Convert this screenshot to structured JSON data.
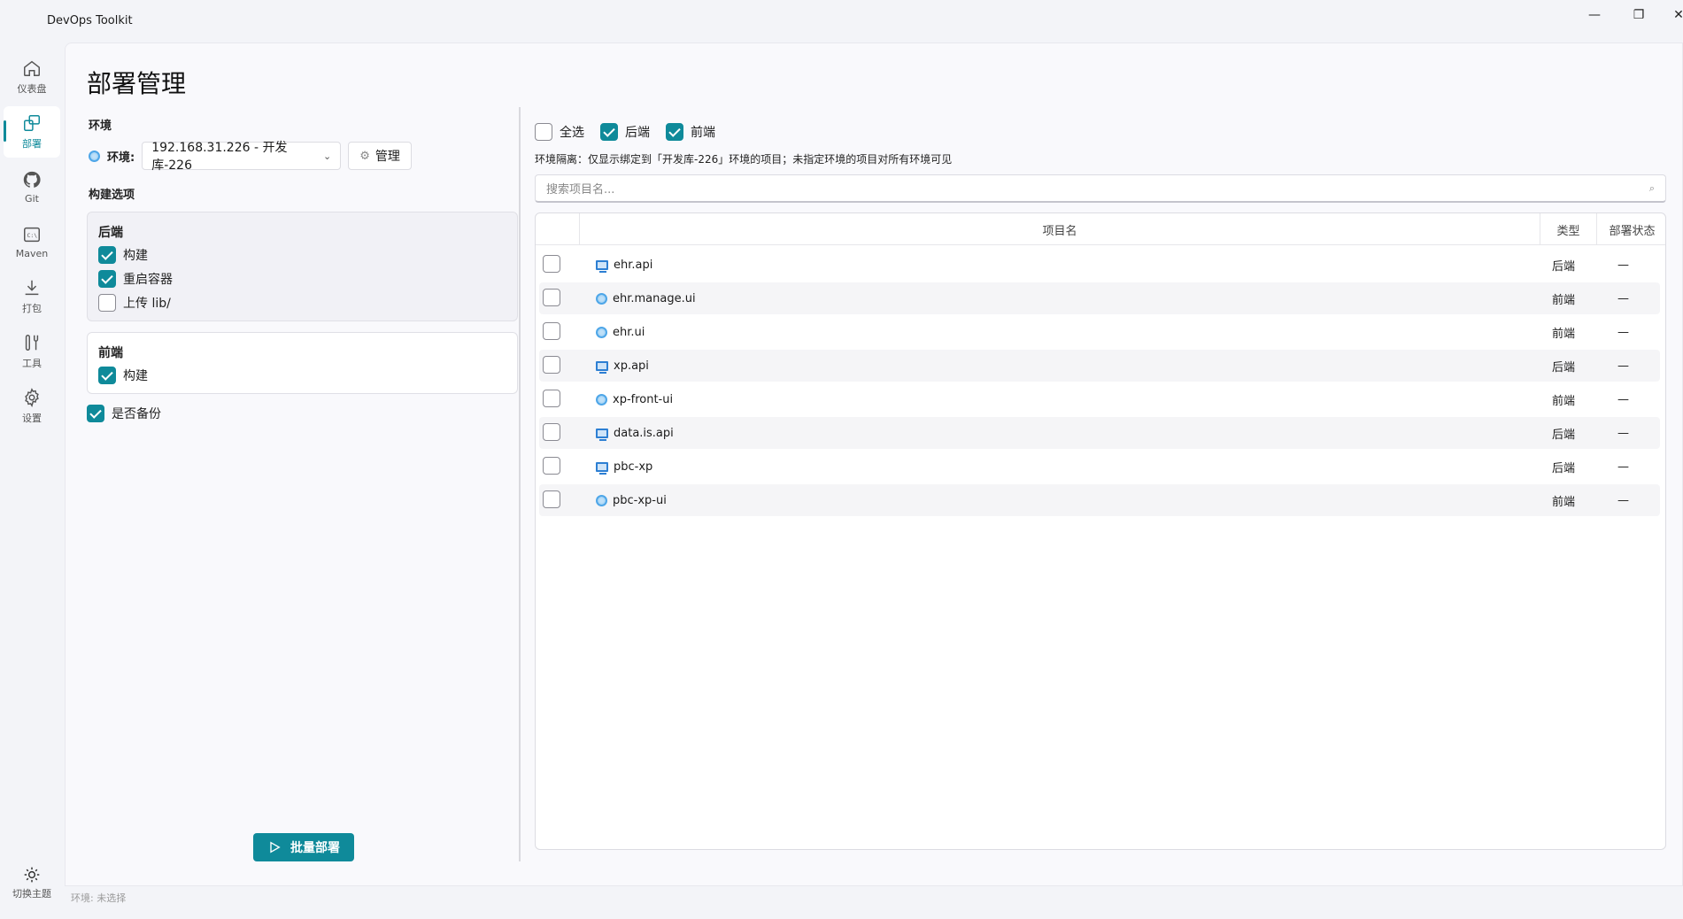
{
  "app": {
    "title": "DevOps Toolkit"
  },
  "window": {
    "minimize": "—",
    "maximize": "❐",
    "close": "✕"
  },
  "nav": {
    "items": [
      {
        "label": "仪表盘",
        "icon": "home-icon"
      },
      {
        "label": "部署",
        "icon": "deploy-icon"
      },
      {
        "label": "Git",
        "icon": "github-icon"
      },
      {
        "label": "Maven",
        "icon": "terminal-icon"
      },
      {
        "label": "打包",
        "icon": "download-icon"
      },
      {
        "label": "工具",
        "icon": "tools-icon"
      },
      {
        "label": "设置",
        "icon": "gear-icon"
      }
    ],
    "theme_label": "切换主题"
  },
  "page": {
    "title": "部署管理"
  },
  "env": {
    "section_label": "环境",
    "label": "环境:",
    "selected": "192.168.31.226 - 开发库-226",
    "manage_label": "管理"
  },
  "build": {
    "section_label": "构建选项",
    "backend": {
      "title": "后端",
      "options": [
        {
          "label": "构建",
          "checked": true
        },
        {
          "label": "重启容器",
          "checked": true
        },
        {
          "label": "上传 lib/",
          "checked": false
        }
      ]
    },
    "frontend": {
      "title": "前端",
      "options": [
        {
          "label": "构建",
          "checked": true
        }
      ]
    },
    "backup_label": "是否备份",
    "backup_checked": true
  },
  "deploy_button": "批量部署",
  "filters": {
    "select_all": "全选",
    "backend": "后端",
    "frontend": "前端"
  },
  "note": "环境隔离：仅显示绑定到「开发库-226」环境的项目；未指定环境的项目对所有环境可见",
  "search": {
    "placeholder": "搜索项目名..."
  },
  "table": {
    "headers": {
      "name": "项目名",
      "type": "类型",
      "status": "部署状态"
    },
    "rows": [
      {
        "name": "ehr.api",
        "type": "后端",
        "status": "—",
        "icon": "monitor-icon"
      },
      {
        "name": "ehr.manage.ui",
        "type": "前端",
        "status": "—",
        "icon": "globe-icon"
      },
      {
        "name": "ehr.ui",
        "type": "前端",
        "status": "—",
        "icon": "globe-icon"
      },
      {
        "name": "xp.api",
        "type": "后端",
        "status": "—",
        "icon": "monitor-icon"
      },
      {
        "name": "xp-front-ui",
        "type": "前端",
        "status": "—",
        "icon": "globe-icon"
      },
      {
        "name": "data.is.api",
        "type": "后端",
        "status": "—",
        "icon": "monitor-icon"
      },
      {
        "name": "pbc-xp",
        "type": "后端",
        "status": "—",
        "icon": "monitor-icon"
      },
      {
        "name": "pbc-xp-ui",
        "type": "前端",
        "status": "—",
        "icon": "globe-icon"
      }
    ]
  },
  "status_bar": "环境: 未选择",
  "colors": {
    "accent": "#0f8a9a",
    "background": "#f3f4f8"
  }
}
